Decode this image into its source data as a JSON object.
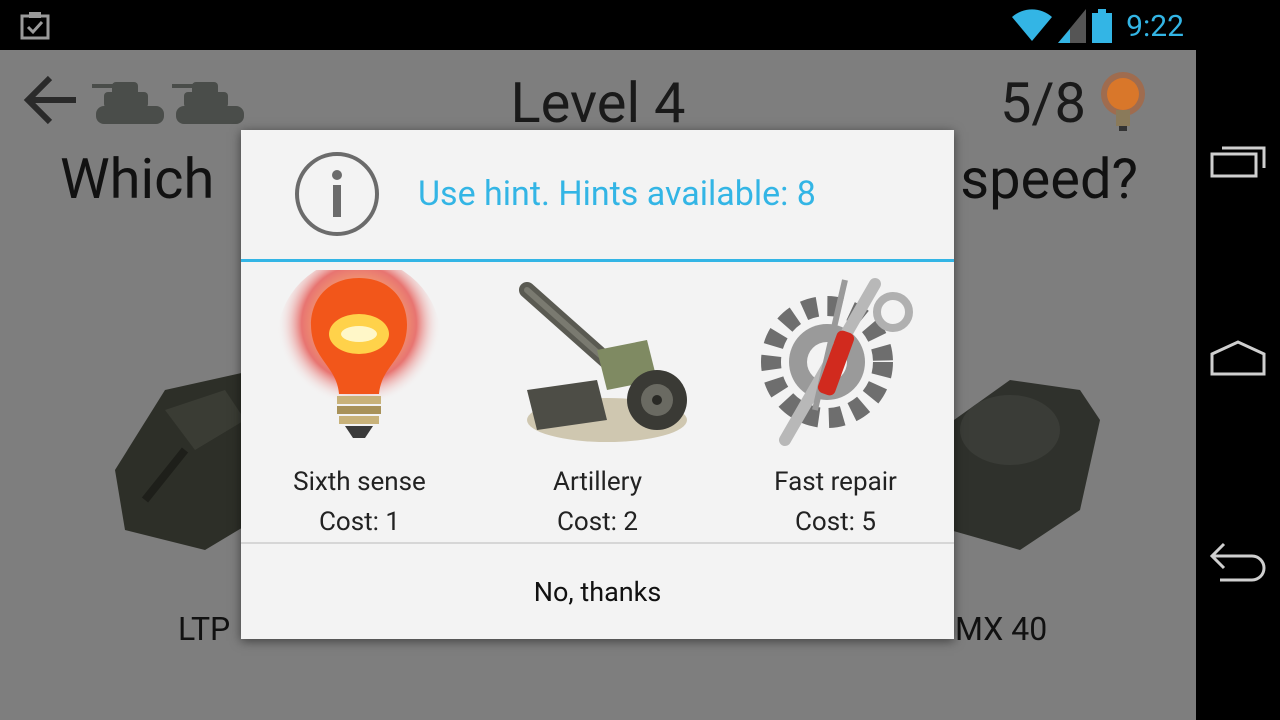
{
  "status_bar": {
    "time": "9:22",
    "left_icon": "clipboard-check-icon",
    "icons": [
      "wifi-icon",
      "signal-icon",
      "battery-icon"
    ]
  },
  "game": {
    "level_title": "Level 4",
    "hint_counter": "5/8",
    "question_left": "Which",
    "question_right": "speed?",
    "tank_label_left": "LTP",
    "tank_label_right": "MX 40",
    "icons": [
      "back-arrow-icon",
      "tank-life-icon",
      "lightbulb-icon"
    ]
  },
  "dialog": {
    "title": "Use hint. Hints available: 8",
    "options": [
      {
        "name": "Sixth sense",
        "cost": "Cost: 1",
        "icon": "lightbulb-icon"
      },
      {
        "name": "Artillery",
        "cost": "Cost: 2",
        "icon": "artillery-icon"
      },
      {
        "name": "Fast repair",
        "cost": "Cost: 5",
        "icon": "repair-tools-icon"
      }
    ],
    "dismiss_label": "No, thanks"
  },
  "nav_bar": {
    "buttons": [
      "recent-apps-icon",
      "home-icon",
      "back-icon"
    ]
  },
  "colors": {
    "accent": "#33b5e5",
    "dialog_bg": "#f3f3f3",
    "overlay_bg": "#7e7e7e"
  }
}
